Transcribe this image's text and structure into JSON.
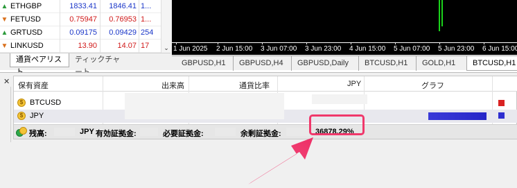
{
  "market_watch": {
    "rows": [
      {
        "direction": "up",
        "symbol": "ETHGBP",
        "bid": "1833.41",
        "ask": "1846.41",
        "spread": "1..."
      },
      {
        "direction": "down",
        "symbol": "FETUSD",
        "bid": "0.75947",
        "ask": "0.76953",
        "spread": "1..."
      },
      {
        "direction": "up",
        "symbol": "GRTUSD",
        "bid": "0.09175",
        "ask": "0.09429",
        "spread": "254"
      },
      {
        "direction": "down",
        "symbol": "LINKUSD",
        "bid": "13.90",
        "ask": "14.07",
        "spread": "17"
      }
    ],
    "tabs": [
      "通貨ペアリスト",
      "ティックチャート"
    ],
    "active_tab": "通貨ペアリスト"
  },
  "chart": {
    "time_labels": [
      "1 Jun 2025",
      "2 Jun 15:00",
      "3 Jun 07:00",
      "3 Jun 23:00",
      "4 Jun 15:00",
      "5 Jun 07:00",
      "5 Jun 23:00",
      "6 Jun 15:00"
    ],
    "tabs": [
      "GBPUSD,H1",
      "GBPUSD,H4",
      "GBPUSD,Daily",
      "BTCUSD,H1",
      "GOLD,H1",
      "BTCUSD,H1"
    ],
    "active_tab_index": 5
  },
  "terminal": {
    "columns": [
      "保有資産",
      "出来高",
      "通貨比率",
      "JPY",
      "グラフ"
    ],
    "rows": [
      {
        "name": "BTCUSD",
        "volume": "",
        "ratio": "",
        "jpy": ""
      },
      {
        "name": "JPY",
        "volume": "",
        "ratio": "",
        "jpy": ""
      }
    ],
    "summary": {
      "balance_label": "残高:",
      "currency": "JPY",
      "equity_label": "有効証拠金:",
      "margin_label": "必要証拠金:",
      "free_margin_label": "余剰証拠金:",
      "margin_level": "36878.29%"
    }
  },
  "colors": {
    "highlight": "#f0386b",
    "bid_ask": "#1a36c8",
    "bid_ask_down": "#d01818",
    "chart_bg": "#000000",
    "candle": "#1bd21b"
  }
}
